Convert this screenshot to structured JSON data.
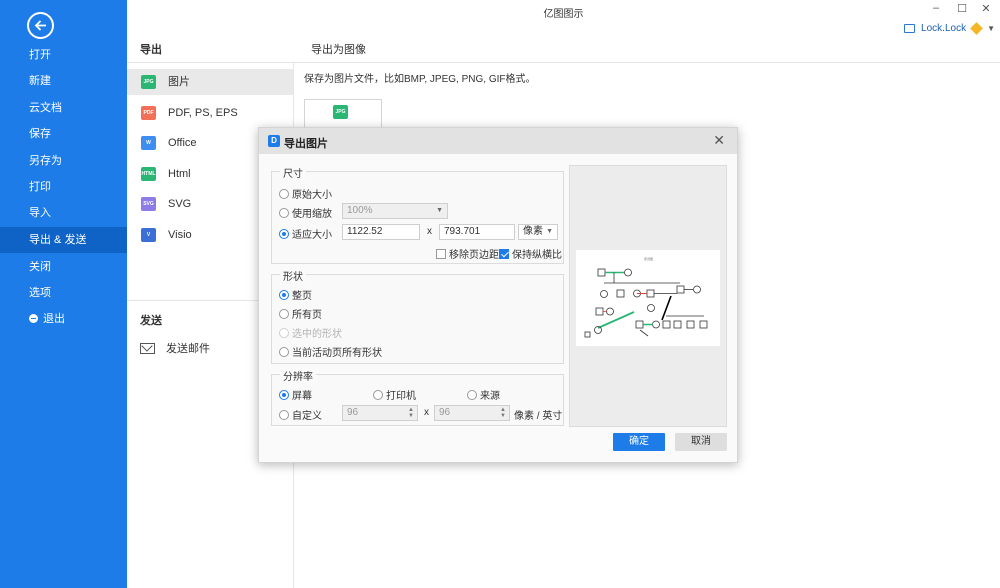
{
  "app": {
    "title": "亿图图示"
  },
  "window_controls": {
    "minimize": "–",
    "maximize": "☐",
    "close": "✕"
  },
  "user": {
    "name": "Lock.Lock"
  },
  "sidebar": {
    "items": [
      {
        "label": "打开"
      },
      {
        "label": "新建"
      },
      {
        "label": "云文档"
      },
      {
        "label": "保存"
      },
      {
        "label": "另存为"
      },
      {
        "label": "打印"
      },
      {
        "label": "导入"
      },
      {
        "label": "导出 & 发送",
        "active": true
      },
      {
        "label": "关闭"
      },
      {
        "label": "选项"
      },
      {
        "label": "退出"
      }
    ]
  },
  "export_panel": {
    "heading": "导出",
    "formats": [
      {
        "icon": "JPG",
        "label": "图片",
        "color": "#2bb673",
        "active": true
      },
      {
        "icon": "PDF",
        "label": "PDF, PS, EPS",
        "color": "#f2705a"
      },
      {
        "icon": "W",
        "label": "Office",
        "color": "#3d8ef0"
      },
      {
        "icon": "HTML",
        "label": "Html",
        "color": "#2bb673"
      },
      {
        "icon": "SVG",
        "label": "SVG",
        "color": "#8c7ce6"
      },
      {
        "icon": "V",
        "label": "Visio",
        "color": "#3b6fd6"
      }
    ],
    "send_heading": "发送",
    "send_item": "发送邮件"
  },
  "content": {
    "heading": "导出为图像",
    "description": "保存为图片文件，比如BMP, JPEG, PNG, GIF格式。",
    "thumb_icon": "JPG"
  },
  "dialog": {
    "title": "导出图片",
    "size_group": {
      "label": "尺寸",
      "original": "原始大小",
      "use_zoom": "使用缩放",
      "zoom_value": "100%",
      "fit_size": "适应大小",
      "width": "1122.52",
      "x": "x",
      "height": "793.701",
      "unit": "像素",
      "remove_margin": "移除页边距",
      "keep_ratio": "保持纵横比"
    },
    "shape_group": {
      "label": "形状",
      "current_page": "整页",
      "all_pages": "所有页",
      "selected": "选中的形状",
      "all_shapes": "当前活动页所有形状"
    },
    "resolution_group": {
      "label": "分辨率",
      "screen": "屏幕",
      "printer": "打印机",
      "source": "来源",
      "custom": "自定义",
      "dpi_x": "96",
      "x": "x",
      "dpi_y": "96",
      "unit": "像素 / 英寸"
    },
    "ok": "确定",
    "cancel": "取消"
  }
}
